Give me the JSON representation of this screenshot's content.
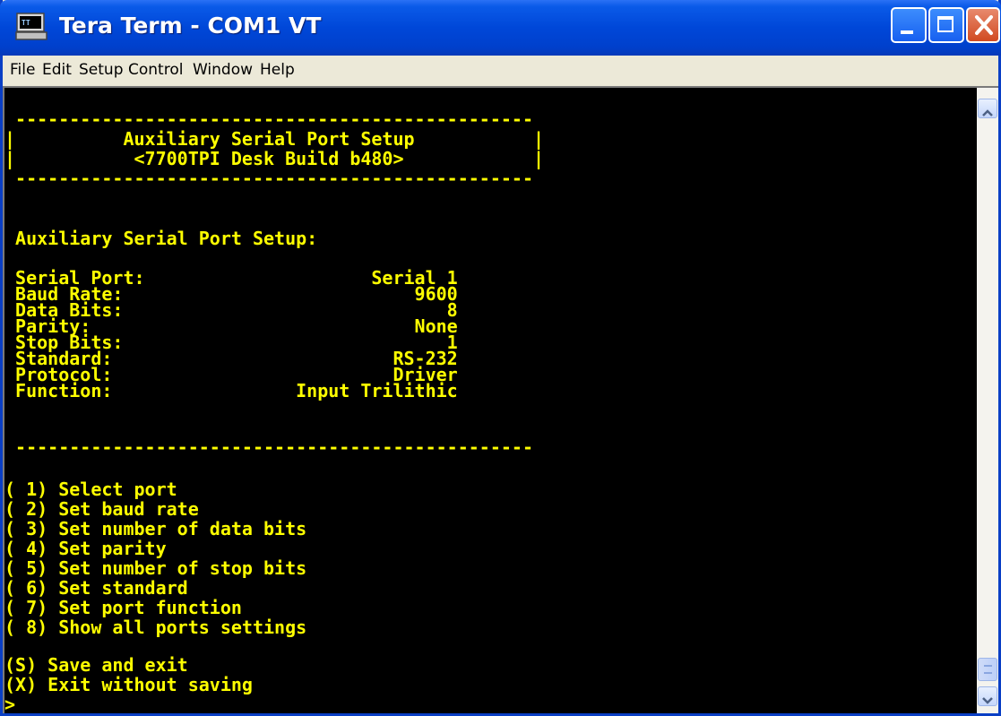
{
  "window": {
    "title": "Tera Term - COM1 VT",
    "icon": "terminal-app-icon",
    "controls": [
      "minimize-icon",
      "maximize-icon",
      "close-icon"
    ],
    "title_bar_color": "#0047d8"
  },
  "menu": [
    {
      "label": "File"
    },
    {
      "label": "Edit"
    },
    {
      "label": "Setup"
    },
    {
      "label": "Control"
    },
    {
      "label": "Window"
    },
    {
      "label": "Help"
    }
  ],
  "terminal": {
    "text_color": "#ffff00",
    "background": "#000000",
    "lines": [
      " ------------------------------------------------",
      "|          Auxiliary Serial Port Setup           |",
      "|           <7700TPI Desk Build b480>            |",
      " ------------------------------------------------",
      " Auxiliary Serial Port Setup:",
      " Serial Port:                     Serial 1",
      " Baud Rate:                           9600",
      " Data Bits:                              8",
      " Parity:                              None",
      " Stop Bits:                              1",
      " Standard:                          RS-232",
      " Protocol:                          Driver",
      " Function:                 Input Trilithic",
      " ------------------------------------------------",
      "( 1) Select port",
      "( 2) Set baud rate",
      "( 3) Set number of data bits",
      "( 4) Set parity",
      "( 5) Set number of stop bits",
      "( 6) Set standard",
      "( 7) Set port function",
      "( 8) Show all ports settings",
      "(S) Save and exit",
      "(X) Exit without saving",
      ">"
    ]
  }
}
